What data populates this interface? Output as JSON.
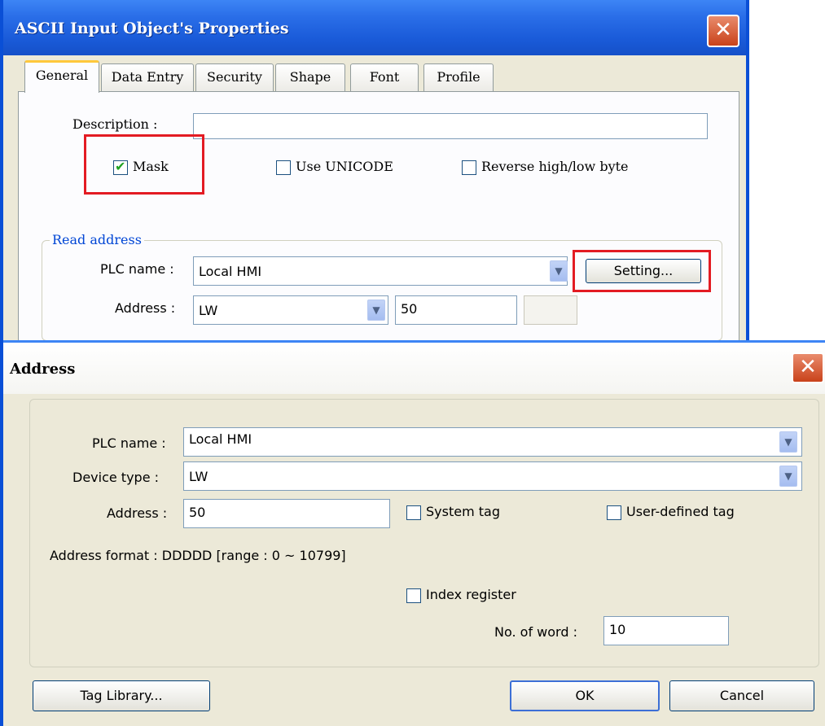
{
  "props_window": {
    "title": "ASCII Input Object's Properties",
    "close_symbol": "✕",
    "tabs": [
      {
        "label": "General"
      },
      {
        "label": "Data Entry"
      },
      {
        "label": "Security"
      },
      {
        "label": "Shape"
      },
      {
        "label": "Font"
      },
      {
        "label": "Profile"
      }
    ],
    "description_label": "Description :",
    "description_value": "",
    "mask_label": "Mask",
    "mask_checked": true,
    "unicode_label": "Use UNICODE",
    "reverse_label": "Reverse high/low byte",
    "read_address_label": "Read address",
    "plc_name_label": "PLC name :",
    "plc_name_value": "Local HMI",
    "setting_button": "Setting...",
    "address_label": "Address :",
    "device_value": "LW",
    "address_value": "50"
  },
  "address_window": {
    "title": "Address",
    "close_symbol": "✕",
    "plc_name_label": "PLC name :",
    "plc_name_value": "Local HMI",
    "device_type_label": "Device type :",
    "device_type_value": "LW",
    "address_label": "Address :",
    "address_value": "50",
    "system_tag_label": "System tag",
    "user_defined_tag_label": "User-defined tag",
    "address_format": "Address format : DDDDD [range : 0 ~ 10799]",
    "index_register_label": "Index register",
    "no_of_word_label": "No. of word :",
    "no_of_word_value": "10",
    "tag_library_button": "Tag Library...",
    "ok_button": "OK",
    "cancel_button": "Cancel"
  },
  "colors": {
    "highlight_red": "#e31b23",
    "titlebar_blue": "#1a5bd9",
    "dialog_bg": "#ece9d8"
  }
}
